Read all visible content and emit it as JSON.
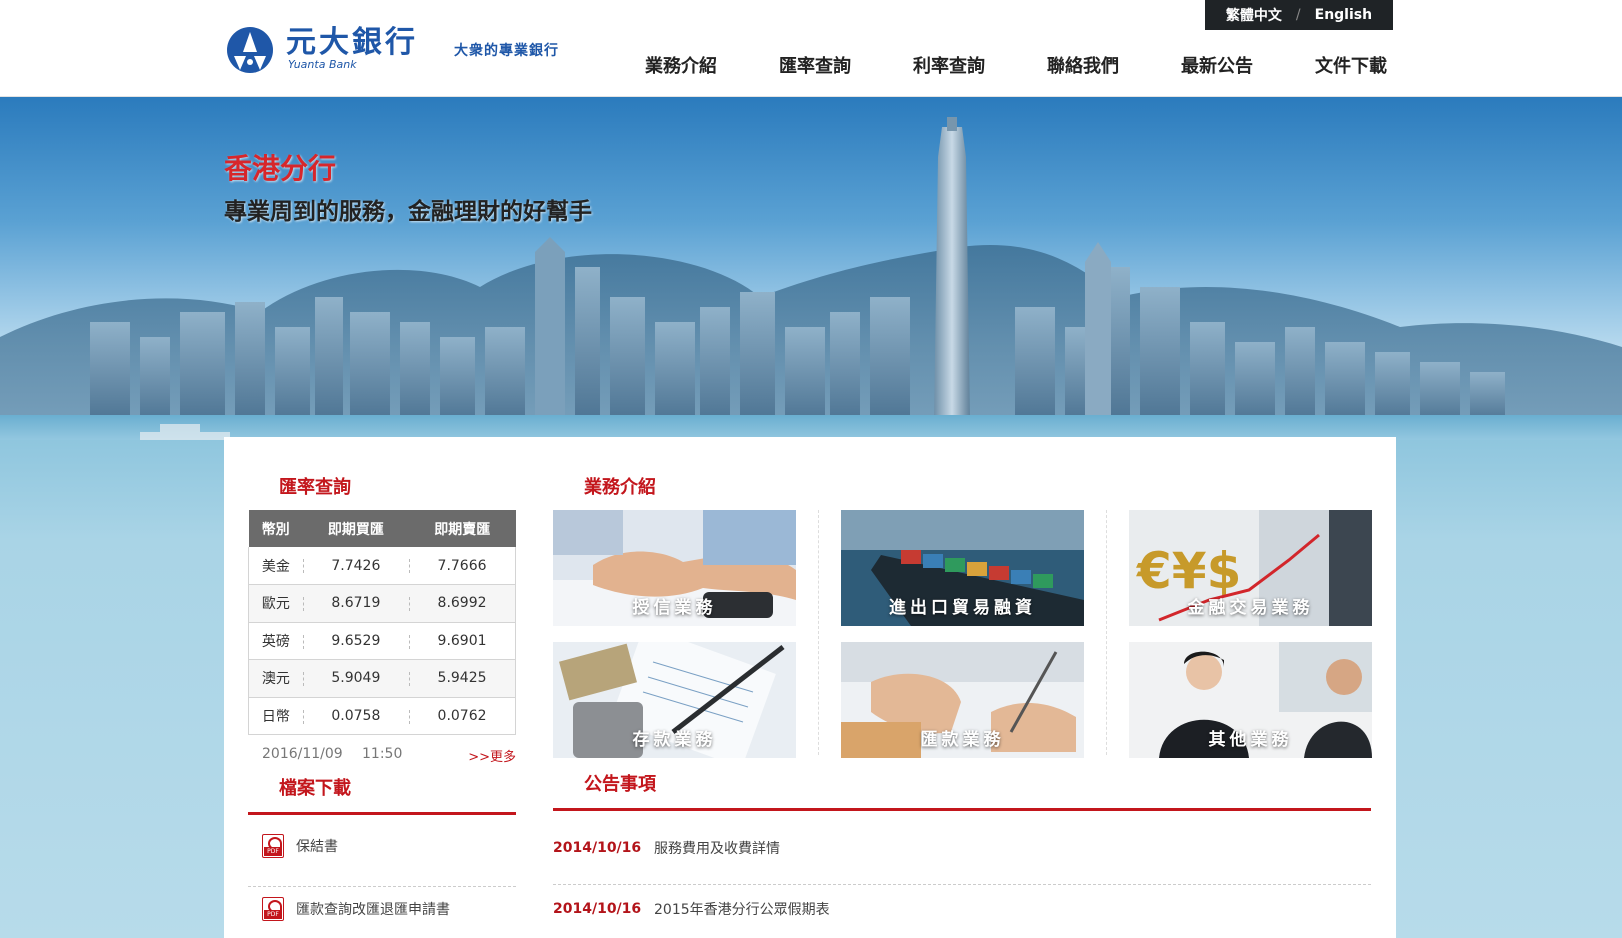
{
  "lang": {
    "zh": "繁體中文",
    "sep": "/",
    "en": "English"
  },
  "logo": {
    "cn": "元大銀行",
    "en": "Yuanta Bank",
    "slogan": "大衆的專業銀行"
  },
  "nav": [
    "業務介紹",
    "匯率查詢",
    "利率查詢",
    "聯絡我們",
    "最新公告",
    "文件下載"
  ],
  "banner": {
    "title": "香港分行",
    "subtitle": "專業周到的服務，金融理財的好幫手"
  },
  "rates": {
    "title": "匯率查詢",
    "headers": [
      "幣別",
      "即期買匯",
      "即期賣匯"
    ],
    "rows": [
      [
        "美金",
        "7.7426",
        "7.7666"
      ],
      [
        "歐元",
        "8.6719",
        "8.6992"
      ],
      [
        "英磅",
        "9.6529",
        "9.6901"
      ],
      [
        "澳元",
        "5.9049",
        "5.9425"
      ],
      [
        "日幣",
        "0.0758",
        "0.0762"
      ]
    ],
    "date": "2016/11/09",
    "time": "11:50",
    "more": ">>更多"
  },
  "files": {
    "title": "檔案下載",
    "items": [
      "保結書",
      "匯款查詢改匯退匯申請書"
    ]
  },
  "services": {
    "title": "業務介紹",
    "items": [
      "授信業務",
      "進出口貿易融資",
      "金融交易業務",
      "存款業務",
      "匯款業務",
      "其他業務"
    ]
  },
  "news": {
    "title": "公告事項",
    "items": [
      {
        "date": "2014/10/16",
        "title": "服務費用及收費詳情"
      },
      {
        "date": "2014/10/16",
        "title": "2015年香港分行公眾假期表"
      }
    ]
  },
  "colors": {
    "accent": "#c3161c",
    "brand": "#1f57a8",
    "dark": "#1f2326"
  }
}
